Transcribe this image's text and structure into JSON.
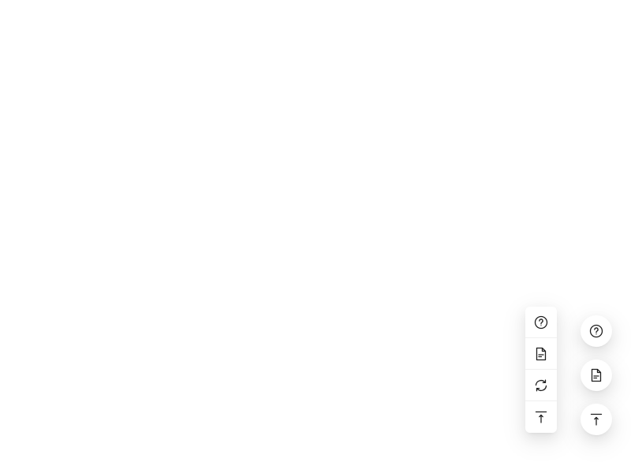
{
  "float_group_square": {
    "buttons": [
      {
        "icon": "question-circle-icon"
      },
      {
        "icon": "file-text-icon"
      },
      {
        "icon": "sync-icon"
      },
      {
        "icon": "vertical-align-top-icon"
      }
    ]
  },
  "float_circle": {
    "buttons": [
      {
        "icon": "question-circle-icon"
      },
      {
        "icon": "file-text-icon"
      },
      {
        "icon": "vertical-align-top-icon"
      }
    ]
  },
  "colors": {
    "background": "#ffffff",
    "icon": "#1f1f1f"
  }
}
